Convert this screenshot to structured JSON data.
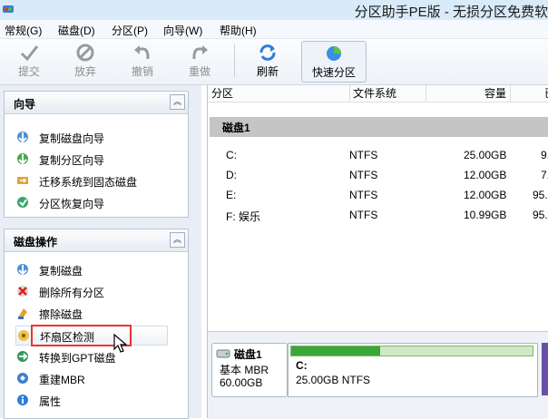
{
  "window": {
    "title": "分区助手PE版 - 无损分区免费软"
  },
  "menu": [
    "常规(G)",
    "磁盘(D)",
    "分区(P)",
    "向导(W)",
    "帮助(H)"
  ],
  "toolbar": {
    "commit": "提交",
    "discard": "放弃",
    "undo": "撤销",
    "redo": "重做",
    "refresh": "刷新",
    "quick_partition": "快速分区"
  },
  "wizard_panel": {
    "title": "向导",
    "items": [
      "复制磁盘向导",
      "复制分区向导",
      "迁移系统到固态磁盘",
      "分区恢复向导"
    ]
  },
  "disk_ops_panel": {
    "title": "磁盘操作",
    "items": [
      "复制磁盘",
      "删除所有分区",
      "擦除磁盘",
      "坏扇区检测",
      "转换到GPT磁盘",
      "重建MBR",
      "属性"
    ]
  },
  "table": {
    "columns": [
      "分区",
      "文件系统",
      "容量",
      "已"
    ],
    "disk_label": "磁盘1",
    "rows": [
      {
        "partition": "C:",
        "fs": "NTFS",
        "capacity": "25.00GB",
        "used": "9."
      },
      {
        "partition": "D:",
        "fs": "NTFS",
        "capacity": "12.00GB",
        "used": "7."
      },
      {
        "partition": "E:",
        "fs": "NTFS",
        "capacity": "12.00GB",
        "used": "95."
      },
      {
        "partition": "F: 娱乐",
        "fs": "NTFS",
        "capacity": "10.99GB",
        "used": "95."
      }
    ]
  },
  "disk_map": {
    "disk_name": "磁盘1",
    "disk_type": "基本 MBR",
    "disk_size": "60.00GB",
    "partition_name": "C:",
    "partition_info": "25.00GB NTFS",
    "used_fraction": 0.37
  }
}
